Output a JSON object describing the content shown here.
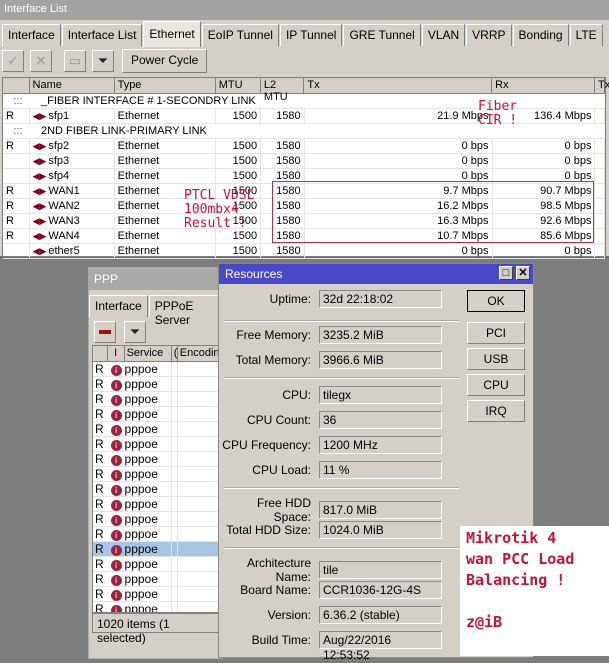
{
  "interface_window": {
    "title": "Interface List",
    "tabs": [
      "Interface",
      "Interface List",
      "Ethernet",
      "EoIP Tunnel",
      "IP Tunnel",
      "GRE Tunnel",
      "VLAN",
      "VRRP",
      "Bonding",
      "LTE"
    ],
    "active_tab": "Ethernet",
    "toolbar": {
      "enable_icon": "checkmark-icon",
      "disable_icon": "cross-icon",
      "comment_icon": "comment-icon",
      "filter_icon": "filter-icon",
      "power_cycle_label": "Power Cycle"
    },
    "columns": [
      "",
      "Name",
      "Type",
      "MTU",
      "L2 MTU",
      "Tx",
      "Rx",
      "Tx"
    ],
    "rows": [
      {
        "comment": "_FIBER INTERFACE # 1-SECONDRY LINK",
        "dots": ":::"
      },
      {
        "flag": "R",
        "name": "sfp1",
        "type": "Ethernet",
        "mtu": "1500",
        "l2mtu": "1580",
        "tx": "21.9 Mbps",
        "rx": "136.4 Mbps"
      },
      {
        "comment": "2ND FIBER LINK-PRIMARY LINK",
        "dots": ":::"
      },
      {
        "flag": "R",
        "name": "sfp2",
        "type": "Ethernet",
        "mtu": "1500",
        "l2mtu": "1580",
        "tx": "0 bps",
        "rx": "0 bps"
      },
      {
        "flag": "",
        "name": "sfp3",
        "type": "Ethernet",
        "mtu": "1500",
        "l2mtu": "1580",
        "tx": "0 bps",
        "rx": "0 bps"
      },
      {
        "flag": "",
        "name": "sfp4",
        "type": "Ethernet",
        "mtu": "1500",
        "l2mtu": "1580",
        "tx": "0 bps",
        "rx": "0 bps"
      },
      {
        "flag": "R",
        "name": "WAN1",
        "type": "Ethernet",
        "mtu": "1500",
        "l2mtu": "1580",
        "tx": "9.7 Mbps",
        "rx": "90.7 Mbps"
      },
      {
        "flag": "R",
        "name": "WAN2",
        "type": "Ethernet",
        "mtu": "1500",
        "l2mtu": "1580",
        "tx": "16.2 Mbps",
        "rx": "98.5 Mbps"
      },
      {
        "flag": "R",
        "name": "WAN3",
        "type": "Ethernet",
        "mtu": "1500",
        "l2mtu": "1580",
        "tx": "16.3 Mbps",
        "rx": "92.6 Mbps"
      },
      {
        "flag": "R",
        "name": "WAN4",
        "type": "Ethernet",
        "mtu": "1500",
        "l2mtu": "1580",
        "tx": "10.7 Mbps",
        "rx": "85.6 Mbps"
      },
      {
        "flag": "",
        "name": "ether5",
        "type": "Ethernet",
        "mtu": "1500",
        "l2mtu": "1580",
        "tx": "0 bps",
        "rx": "0 bps"
      }
    ]
  },
  "annotations": {
    "fiber_line1": "Fiber",
    "fiber_line2": "CIR !",
    "ptcl_line1": "PTCL VDSL",
    "ptcl_line2": "100mbx4",
    "ptcl_line3": "Result !",
    "note_line1": "Mikrotik 4",
    "note_line2": "wan PCC Load",
    "note_line3": "Balancing !",
    "note_line4": "z@iB",
    "accent_color": "#c0143c"
  },
  "ppp_window": {
    "title": "PPP",
    "tabs": [
      "Interface",
      "PPPoE Server"
    ],
    "columns": [
      "",
      "I",
      "Service",
      "(",
      "Encodin"
    ],
    "rows": [
      {
        "flag": "R",
        "service": "pppoe"
      },
      {
        "flag": "R",
        "service": "pppoe"
      },
      {
        "flag": "R",
        "service": "pppoe"
      },
      {
        "flag": "R",
        "service": "pppoe"
      },
      {
        "flag": "R",
        "service": "pppoe"
      },
      {
        "flag": "R",
        "service": "pppoe"
      },
      {
        "flag": "R",
        "service": "pppoe"
      },
      {
        "flag": "R",
        "service": "pppoe"
      },
      {
        "flag": "R",
        "service": "pppoe"
      },
      {
        "flag": "R",
        "service": "pppoe"
      },
      {
        "flag": "R",
        "service": "pppoe"
      },
      {
        "flag": "R",
        "service": "pppoe"
      },
      {
        "flag": "R",
        "service": "pppoe",
        "selected": true
      },
      {
        "flag": "R",
        "service": "pppoe"
      },
      {
        "flag": "R",
        "service": "pppoe"
      },
      {
        "flag": "R",
        "service": "pppoe"
      },
      {
        "flag": "R",
        "service": "pppoe"
      }
    ],
    "status": "1020 items (1 selected)"
  },
  "resources_window": {
    "title": "Resources",
    "fields": {
      "uptime": {
        "label": "Uptime:",
        "value": "32d 22:18:02"
      },
      "free_memory": {
        "label": "Free Memory:",
        "value": "3235.2 MiB"
      },
      "total_memory": {
        "label": "Total Memory:",
        "value": "3966.6 MiB"
      },
      "cpu": {
        "label": "CPU:",
        "value": "tilegx"
      },
      "cpu_count": {
        "label": "CPU Count:",
        "value": "36"
      },
      "cpu_frequency": {
        "label": "CPU Frequency:",
        "value": "1200 MHz"
      },
      "cpu_load": {
        "label": "CPU Load:",
        "value": "11 %"
      },
      "free_hdd": {
        "label": "Free HDD Space:",
        "value": "817.0 MiB"
      },
      "total_hdd": {
        "label": "Total HDD Size:",
        "value": "1024.0 MiB"
      },
      "architecture": {
        "label": "Architecture Name:",
        "value": "tile"
      },
      "board_name": {
        "label": "Board Name:",
        "value": "CCR1036-12G-4S"
      },
      "version": {
        "label": "Version:",
        "value": "6.36.2 (stable)"
      },
      "build_time": {
        "label": "Build Time:",
        "value": "Aug/22/2016 12:53:52"
      }
    },
    "buttons": {
      "ok": "OK",
      "pci": "PCI",
      "usb": "USB",
      "cpu": "CPU",
      "irq": "IRQ"
    },
    "title_color": "#4848c8"
  }
}
